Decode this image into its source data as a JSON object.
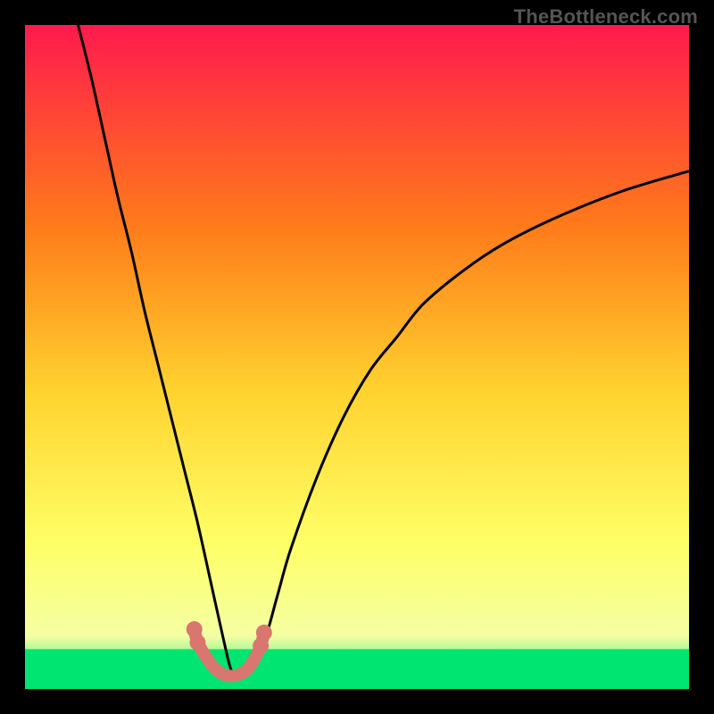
{
  "watermark": "TheBottleneck.com",
  "chart_data": {
    "type": "line",
    "title": "",
    "xlabel": "",
    "ylabel": "",
    "xlim": [
      0,
      100
    ],
    "ylim": [
      0,
      100
    ],
    "background_gradient": {
      "top": "#ff1a4d",
      "mid_upper": "#ff7a1a",
      "mid": "#ffd22e",
      "mid_lower": "#ffff66",
      "near_bottom": "#f4ffa3",
      "bottom": "#00e571"
    },
    "green_band": {
      "y_start": 0,
      "y_end": 6
    },
    "series": [
      {
        "name": "bottleneck-curve",
        "color": "#000000",
        "x": [
          8,
          10,
          12,
          14,
          16,
          18,
          20,
          22,
          24,
          26,
          28,
          30,
          31,
          32,
          34,
          36,
          38,
          40,
          44,
          48,
          52,
          56,
          60,
          66,
          72,
          80,
          90,
          100
        ],
        "y": [
          100,
          92,
          83,
          74,
          66,
          57,
          49,
          41,
          33,
          25,
          16,
          7,
          3,
          2,
          3,
          7,
          14,
          21,
          32,
          41,
          48,
          53,
          58,
          63,
          67,
          71,
          75,
          78
        ]
      }
    ],
    "marker_line": {
      "comment": "pink/coral markers near curve bottom",
      "color": "#d9766f",
      "points_x": [
        25.5,
        26.0,
        27.3,
        28.5,
        29.5,
        30.5,
        31.5,
        32.5,
        33.5,
        34.5,
        35.5,
        36.0
      ],
      "points_y": [
        9.0,
        7.0,
        4.8,
        3.2,
        2.4,
        2.0,
        2.0,
        2.3,
        3.0,
        4.4,
        6.5,
        8.5
      ]
    }
  }
}
